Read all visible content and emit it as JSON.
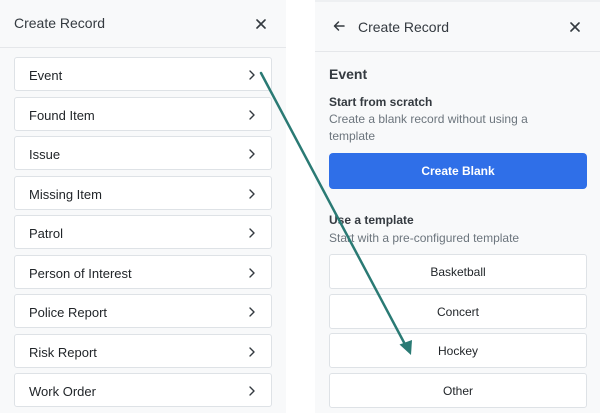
{
  "left": {
    "title": "Create Record",
    "items": [
      {
        "label": "Event"
      },
      {
        "label": "Found Item"
      },
      {
        "label": "Issue"
      },
      {
        "label": "Missing Item"
      },
      {
        "label": "Patrol"
      },
      {
        "label": "Person of Interest"
      },
      {
        "label": "Police Report"
      },
      {
        "label": "Risk Report"
      },
      {
        "label": "Work Order"
      }
    ]
  },
  "right": {
    "title": "Create Record",
    "section_title": "Event",
    "scratch": {
      "heading": "Start from scratch",
      "description": "Create a blank record without using a template",
      "button_label": "Create Blank"
    },
    "template": {
      "heading": "Use a template",
      "description": "Start with a pre-configured template",
      "options": [
        {
          "label": "Basketball"
        },
        {
          "label": "Concert"
        },
        {
          "label": "Hockey"
        },
        {
          "label": "Other"
        }
      ]
    }
  },
  "colors": {
    "primary": "#2f6fe8",
    "arrow": "#2a7a74"
  }
}
